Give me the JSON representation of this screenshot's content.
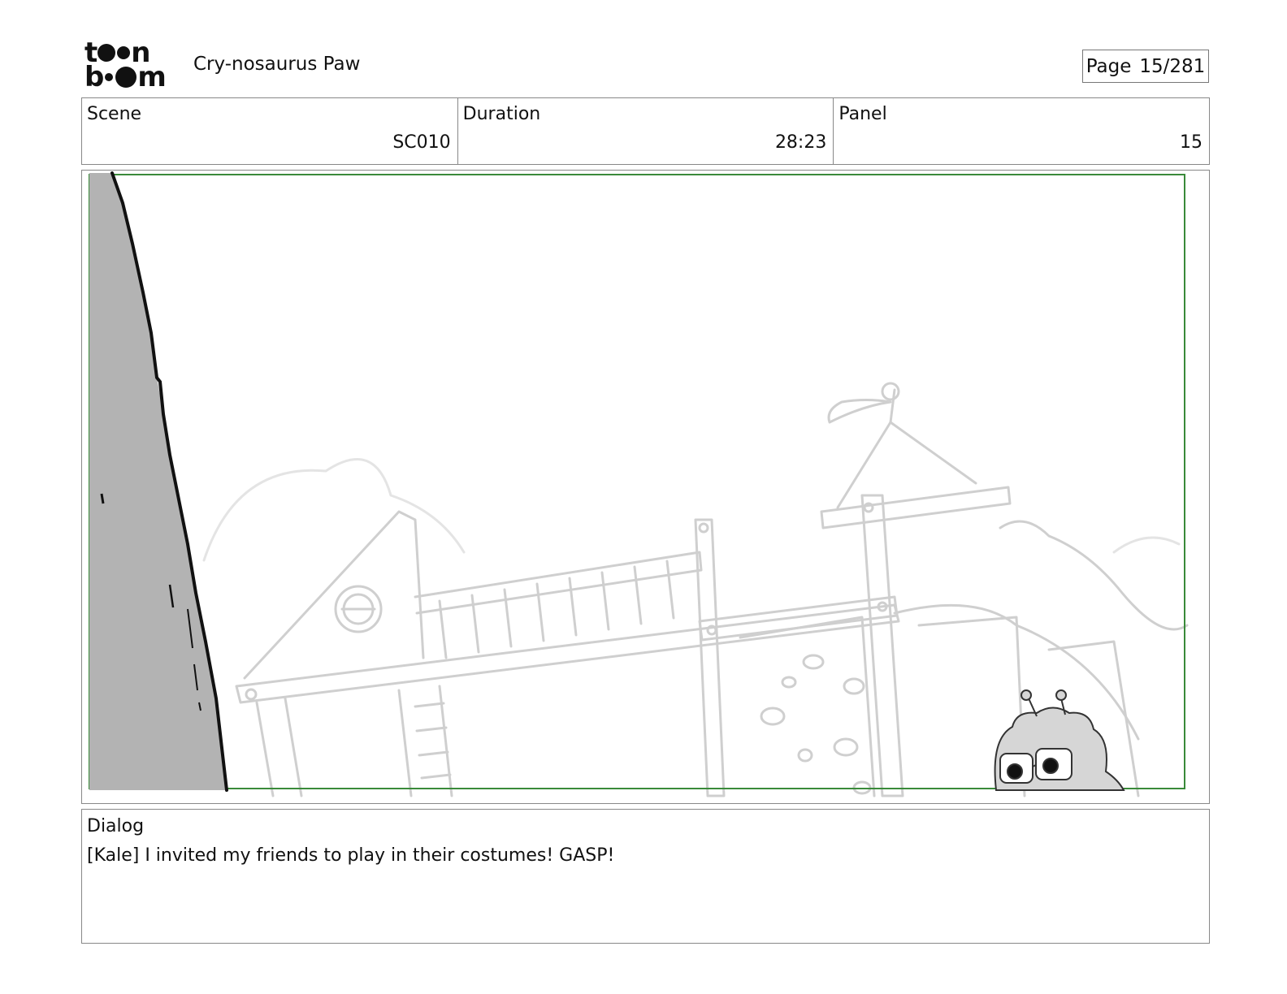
{
  "header": {
    "logo_alt": "toon boom",
    "project_title": "Cry-nosaurus Paw",
    "page_label": "Page",
    "page_value": "15/281"
  },
  "info": {
    "scene_label": "Scene",
    "scene_value": "SC010",
    "duration_label": "Duration",
    "duration_value": "28:23",
    "panel_label": "Panel",
    "panel_value": "15"
  },
  "panel_image": {
    "safe_frame_color": "#3a8a3a",
    "cliff_fill": "#b3b3b3",
    "background_line_color": "#cfcfcf"
  },
  "dialog": {
    "label": "Dialog",
    "text": "[Kale] I invited my friends to play in their costumes! GASP!"
  }
}
